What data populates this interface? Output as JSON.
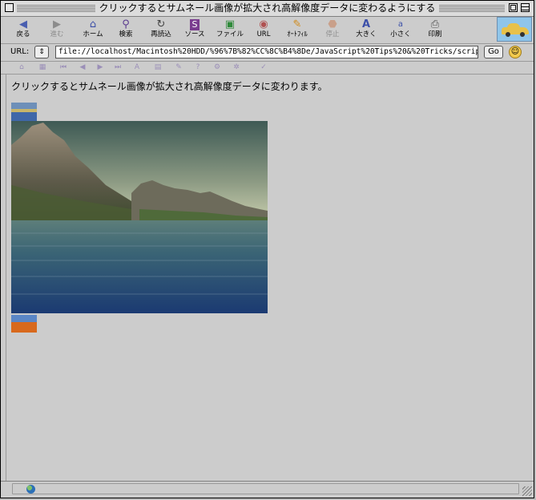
{
  "window": {
    "title": "クリックするとサムネール画像が拡大され高解像度データに変わるようにする"
  },
  "toolbar": {
    "back": "戻る",
    "forward": "進む",
    "home": "ホーム",
    "search": "検索",
    "reload": "再読込",
    "source": "ソース",
    "file": "ファイル",
    "url": "URL",
    "autofill": "ｵｰﾄﾌｨﾙ",
    "stop": "停止",
    "larger": "大きく",
    "smaller": "小さく",
    "print": "印刷"
  },
  "address": {
    "label": "URL:",
    "value": "file://localhost/Macintosh%20HDD/%96%7B%82%CC%8C%B4%8De/JavaScript%20Tips%20&%20Tricks/scrip",
    "go_label": "Go"
  },
  "content": {
    "message": "クリックするとサムネール画像が拡大され高解像度データに変わります。"
  },
  "icons": {
    "back": "arrow-left-icon",
    "forward": "arrow-right-icon",
    "home": "house-icon",
    "search": "magnifier-icon",
    "reload": "reload-icon",
    "source": "source-s-icon",
    "file": "file-icon",
    "url": "globe-icon",
    "autofill": "autofill-icon",
    "stop": "stop-octagon-icon",
    "larger": "font-larger-icon",
    "smaller": "font-smaller-icon",
    "print": "printer-icon"
  }
}
